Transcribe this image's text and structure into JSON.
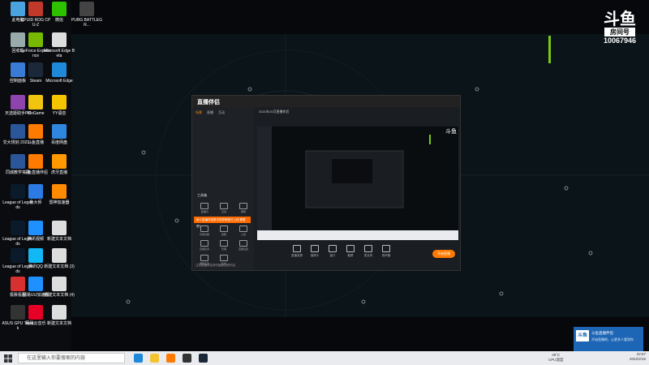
{
  "desktop_icons": [
    {
      "label": "此电脑",
      "color": "#4aa3df"
    },
    {
      "label": "CPUID ROG CPU-Z",
      "color": "#c0392b"
    },
    {
      "label": "微信",
      "color": "#2dc100"
    },
    {
      "label": "PUBG BATTLEGR...",
      "color": "#444"
    },
    {
      "label": "回收站",
      "color": "#9aa"
    },
    {
      "label": "GeForce Experience",
      "color": "#76b900"
    },
    {
      "label": "Microsoft Edge Beta",
      "color": "#ddd"
    },
    {
      "label": "控制面板",
      "color": "#3a7bd5"
    },
    {
      "label": "Steam",
      "color": "#1b2838"
    },
    {
      "label": "Microsoft Edge",
      "color": "#1f88d8"
    },
    {
      "label": "天选姬助手PC",
      "color": "#8e44ad"
    },
    {
      "label": "WeGame",
      "color": "#f1c40f"
    },
    {
      "label": "YY语音",
      "color": "#f5c400"
    },
    {
      "label": "交大规划 2021...",
      "color": "#2b579a"
    },
    {
      "label": "斗鱼直播",
      "color": "#ff7a00"
    },
    {
      "label": "百度网盘",
      "color": "#2e86de"
    },
    {
      "label": "同城教学实录",
      "color": "#2b579a"
    },
    {
      "label": "斗鱼直播伴侣",
      "color": "#ff7a00"
    },
    {
      "label": "虎牙直播",
      "color": "#ff9900"
    },
    {
      "label": "League of Legends",
      "color": "#0a1a2a"
    },
    {
      "label": "鲁大师",
      "color": "#2c7be5"
    },
    {
      "label": "雷神加速器",
      "color": "#ff8c00"
    },
    {
      "label": "League of Legends",
      "color": "#0a1a2a"
    },
    {
      "label": "腾讯视频",
      "color": "#1e90ff"
    },
    {
      "label": "新建文本文档",
      "color": "#ddd"
    },
    {
      "label": "League of Legends",
      "color": "#0a1a2a"
    },
    {
      "label": "腾讯QQ",
      "color": "#12b7f5"
    },
    {
      "label": "新建文本文档 (3)",
      "color": "#ddd"
    },
    {
      "label": "极致看图",
      "color": "#d63031"
    },
    {
      "label": "网易UU加速器",
      "color": "#1e90ff"
    },
    {
      "label": "新建文本文档 (4)",
      "color": "#ddd"
    },
    {
      "label": "ASUS GPU Tweak",
      "color": "#333"
    },
    {
      "label": "网易云音乐",
      "color": "#e60026"
    },
    {
      "label": "新建文本文档",
      "color": "#ddd"
    }
  ],
  "watermark": {
    "logo": "斗鱼",
    "box": "房间号",
    "room": "10067946"
  },
  "app": {
    "title": "直播伴侣",
    "tabs": [
      "场景",
      "直播",
      "互动"
    ],
    "tools_title": "工具箱",
    "promo": "新人直播伴侣新手指导教程已上线 看看吧！",
    "tools": [
      "直播间",
      "互动",
      "弹幕",
      "高级功能",
      "技能",
      "公告",
      "直播任务",
      "管理",
      "直播设置",
      "游戏互动",
      "任务"
    ],
    "bottom_note": "注意直播伴侣请勿播放违规内容",
    "head_text": "2021年10月直播伴侣",
    "controls": [
      "直播录屏",
      "摄像头",
      "窗口",
      "截屏",
      "麦克风",
      "扬声器"
    ],
    "start_label": "开始直播"
  },
  "taskbar": {
    "search_placeholder": "在这里输入你要搜索的内容",
    "weather": "49°C\nCPU温度",
    "time": "22:57",
    "date": "2022/2/16"
  },
  "notification": {
    "logo": "斗鱼",
    "line1": "斗鱼直播伴侣",
    "line2": "开始直播吧，让更多人看到你"
  }
}
